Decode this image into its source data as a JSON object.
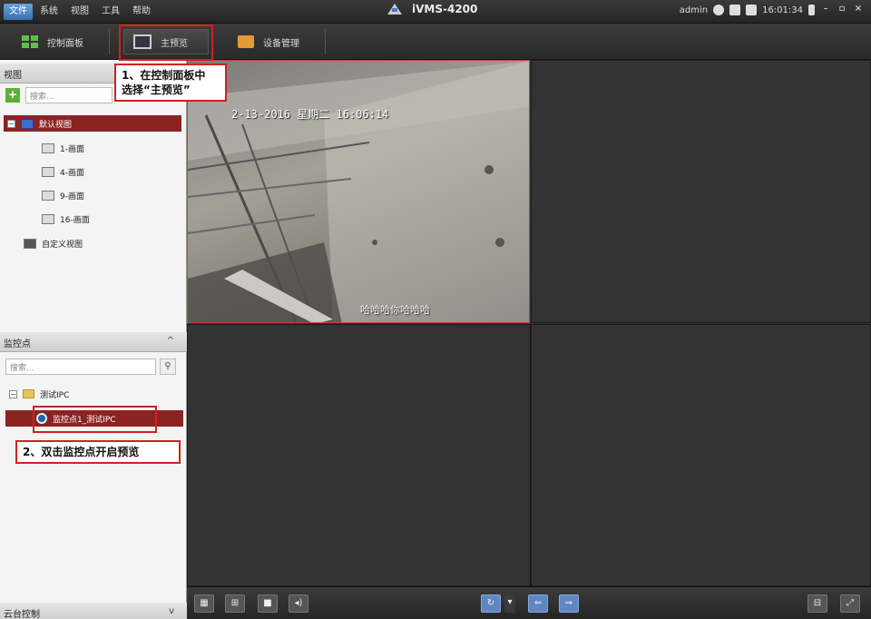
{
  "menu": [
    "文件",
    "系统",
    "视图",
    "工具",
    "帮助"
  ],
  "app_title": "iVMS-4200",
  "status": {
    "user": "admin",
    "time": "16:01:34"
  },
  "toolbar": {
    "control_panel": "控制面板",
    "main_preview": "主预览",
    "device_mgmt": "设备管理"
  },
  "annotation1": {
    "line1": "1、在控制面板中",
    "line2": "选择“主预览”"
  },
  "annotation2": "2、双击监控点开启预览",
  "views_panel": {
    "title": "视图",
    "search_placeholder": "搜索...",
    "default_view": "默认视图",
    "items": [
      "1-画面",
      "4-画面",
      "9-画面",
      "16-画面"
    ],
    "custom_view": "自定义视图"
  },
  "monitor_panel": {
    "title": "监控点",
    "search_placeholder": "搜索...",
    "group": "测试IPC",
    "camera": "监控点1_测试IPC"
  },
  "ptz_panel": {
    "title": "云台控制"
  },
  "video": {
    "timestamp": "2-13-2016 星期二 16:06:14",
    "caption": "哈哈哈你哈哈哈"
  },
  "colors": {
    "highlight": "#d42020",
    "selected_row": "#8b2323",
    "tab_active": "#3a6fb0"
  }
}
